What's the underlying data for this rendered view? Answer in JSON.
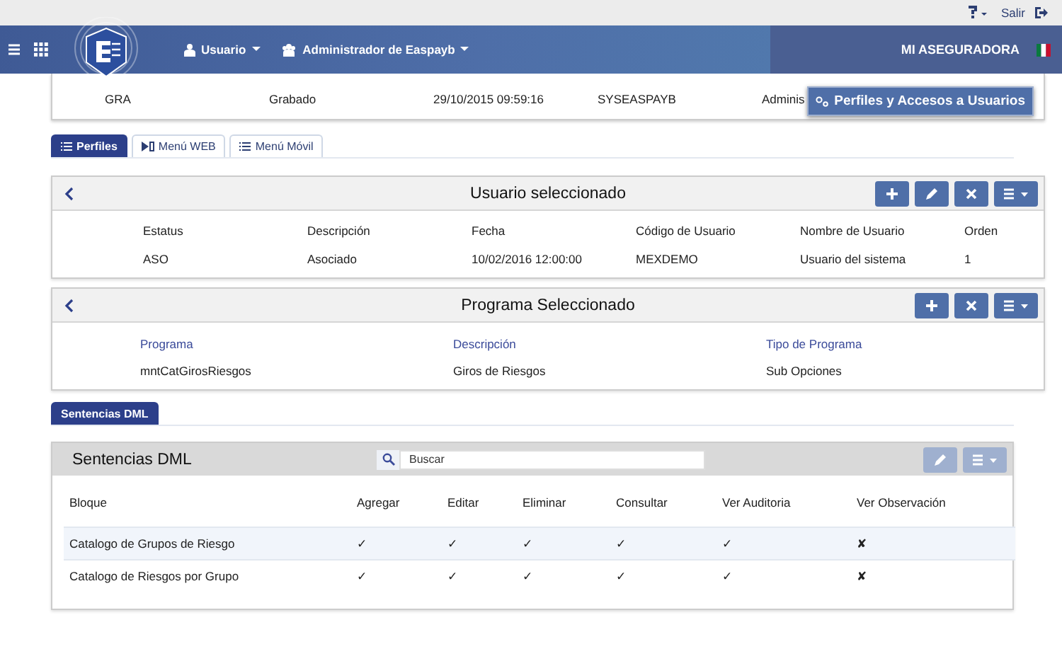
{
  "top_bar": {
    "logout": "Salir"
  },
  "nav": {
    "user_menu": "Usuario",
    "admin_menu": "Administrador de Easpayb",
    "company": "MI ASEGURADORA"
  },
  "record": {
    "values": [
      "GRA",
      "Grabado",
      "29/10/2015 09:59:16",
      "SYSEASPAYB",
      "Adminis"
    ]
  },
  "tooltip": "Perfiles y Accesos a Usuarios",
  "tabs": [
    {
      "label": "Perfiles",
      "selected": true
    },
    {
      "label": "Menú WEB",
      "selected": false
    },
    {
      "label": "Menú Móvil",
      "selected": false
    }
  ],
  "user_panel": {
    "title": "Usuario seleccionado",
    "accent_labels": false,
    "buttons": [
      {
        "kind": "add",
        "disabled": false
      },
      {
        "kind": "edit",
        "disabled": false
      },
      {
        "kind": "delete",
        "disabled": false
      },
      {
        "kind": "menu",
        "disabled": false
      }
    ],
    "fields": [
      {
        "label": "Estatus",
        "value": "ASO"
      },
      {
        "label": "Descripción",
        "value": "Asociado"
      },
      {
        "label": "Fecha",
        "value": "10/02/2016 12:00:00"
      },
      {
        "label": "Código de Usuario",
        "value": "MEXDEMO"
      },
      {
        "label": "Nombre de Usuario",
        "value": "Usuario del sistema"
      },
      {
        "label": "Orden",
        "value": "1"
      }
    ]
  },
  "program_panel": {
    "title": "Programa Seleccionado",
    "accent_labels": true,
    "buttons": [
      {
        "kind": "add",
        "disabled": false
      },
      {
        "kind": "delete",
        "disabled": false
      },
      {
        "kind": "menu",
        "disabled": false
      }
    ],
    "fields": [
      {
        "label": "Programa",
        "value": "mntCatGirosRiesgos"
      },
      {
        "label": "Descripción",
        "value": "Giros de Riesgos"
      },
      {
        "label": "Tipo de Programa",
        "value": "Sub Opciones"
      }
    ]
  },
  "sub_tabs": [
    {
      "label": "Sentencias DML",
      "selected": true
    }
  ],
  "dml_panel": {
    "title": "Sentencias DML",
    "search": {
      "placeholder": "Buscar"
    },
    "buttons": [
      {
        "kind": "edit",
        "disabled": true
      },
      {
        "kind": "menu",
        "disabled": true
      }
    ],
    "columns": [
      "Bloque",
      "Agregar",
      "Editar",
      "Eliminar",
      "Consultar",
      "Ver Auditoria",
      "Ver Observación"
    ],
    "rows": [
      {
        "highlighted": true,
        "cells": [
          "Catalogo de Grupos de Riesgo",
          "✓",
          "✓",
          "✓",
          "✓",
          "✓",
          "✘"
        ]
      },
      {
        "highlighted": false,
        "cells": [
          "Catalogo de Riesgos por Grupo",
          "✓",
          "✓",
          "✓",
          "✓",
          "✓",
          "✘"
        ]
      }
    ]
  }
}
